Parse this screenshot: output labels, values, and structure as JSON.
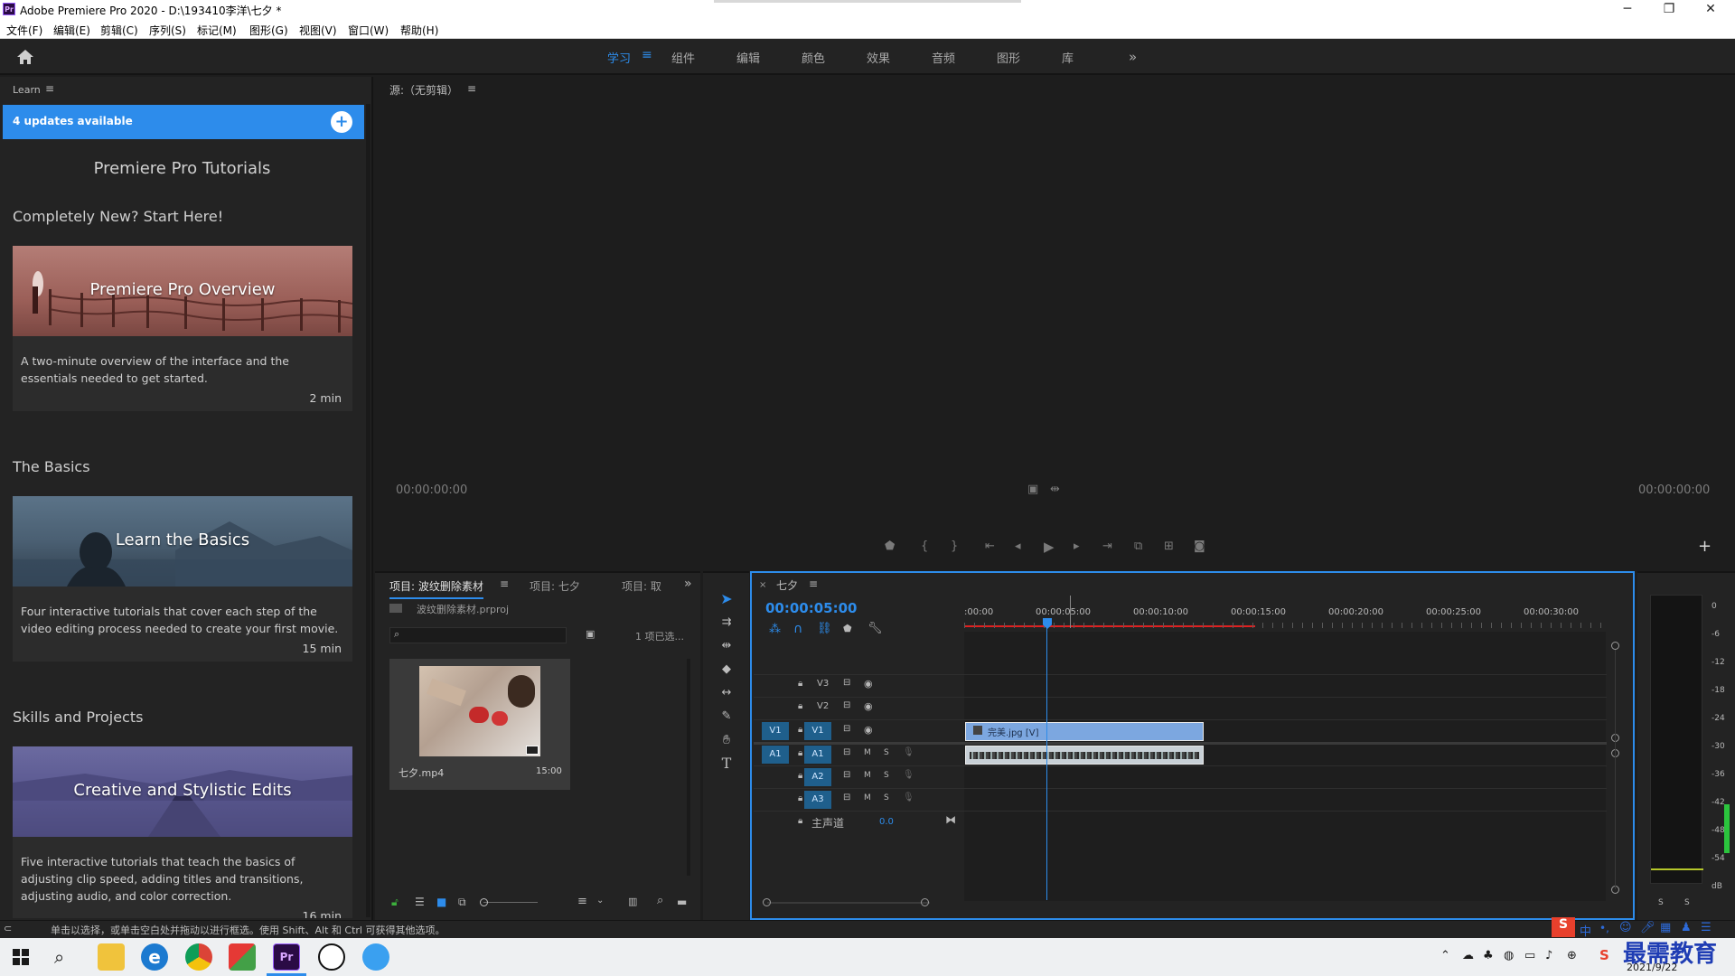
{
  "window": {
    "title": "Adobe Premiere Pro 2020 - D:\\193410李洋\\七夕 *",
    "logo": "Pr",
    "controls": [
      "─",
      "❐",
      "✕"
    ]
  },
  "menu": [
    "文件(F)",
    "编辑(E)",
    "剪辑(C)",
    "序列(S)",
    "标记(M)",
    "图形(G)",
    "视图(V)",
    "窗口(W)",
    "帮助(H)"
  ],
  "workspaces": {
    "tabs": [
      "学习",
      "组件",
      "编辑",
      "颜色",
      "效果",
      "音频",
      "图形",
      "库"
    ],
    "active": "学习",
    "more": "»"
  },
  "learn": {
    "panel_title": "Learn",
    "updates": "4 updates available",
    "heading": "Premiere Pro Tutorials",
    "sections": [
      {
        "title": "Completely New? Start Here!",
        "card": {
          "title": "Premiere Pro Overview",
          "desc": "A two-minute overview of the interface and the essentials needed to get started.",
          "duration": "2 min"
        }
      },
      {
        "title": "The Basics",
        "card": {
          "title": "Learn the Basics",
          "desc": "Four interactive tutorials that cover each step of the video editing process needed to create your first movie.",
          "duration": "15 min"
        }
      },
      {
        "title": "Skills and Projects",
        "card": {
          "title": "Creative and Stylistic Edits",
          "desc": "Five interactive tutorials that teach the basics of adjusting clip speed, adding titles and transitions, adjusting audio, and color correction.",
          "duration": "16 min"
        }
      }
    ]
  },
  "source": {
    "title": "源:（无剪辑）",
    "tc_left": "00:00:00:00",
    "tc_right": "00:00:00:00"
  },
  "project": {
    "tabs": [
      "项目: 波纹删除素材",
      "项目: 七夕",
      "项目: 取"
    ],
    "file": "波纹删除素材.prproj",
    "selected": "1 项已选...",
    "clip_name": "七夕.mp4",
    "clip_duration": "15:00"
  },
  "timeline": {
    "seq_name": "七夕",
    "timecode": "00:00:05:00",
    "ruler": [
      ":00:00",
      "00:00:05:00",
      "00:00:10:00",
      "00:00:15:00",
      "00:00:20:00",
      "00:00:25:00",
      "00:00:30:00"
    ],
    "video_tracks": [
      "V3",
      "V2",
      "V1"
    ],
    "audio_tracks": [
      "A1",
      "A2",
      "A3"
    ],
    "src_v": "V1",
    "src_a": "A1",
    "master": "主声道",
    "master_val": "0.0",
    "video_clip": "完美.jpg [V]",
    "m_label": "M",
    "s_label": "S"
  },
  "meter": {
    "scale": [
      "0",
      "-6",
      "-12",
      "-18",
      "-24",
      "-30",
      "-36",
      "-42",
      "-48",
      "-54",
      "dB"
    ],
    "s_labels": [
      "S",
      "S"
    ]
  },
  "status": "单击以选择，或单击空白处并拖动以进行框选。使用 Shift、Alt 和 Ctrl 可获得其他选项。",
  "taskbar": {
    "ime": "中",
    "watermark": "最需教育",
    "date": "2021/9/22"
  }
}
